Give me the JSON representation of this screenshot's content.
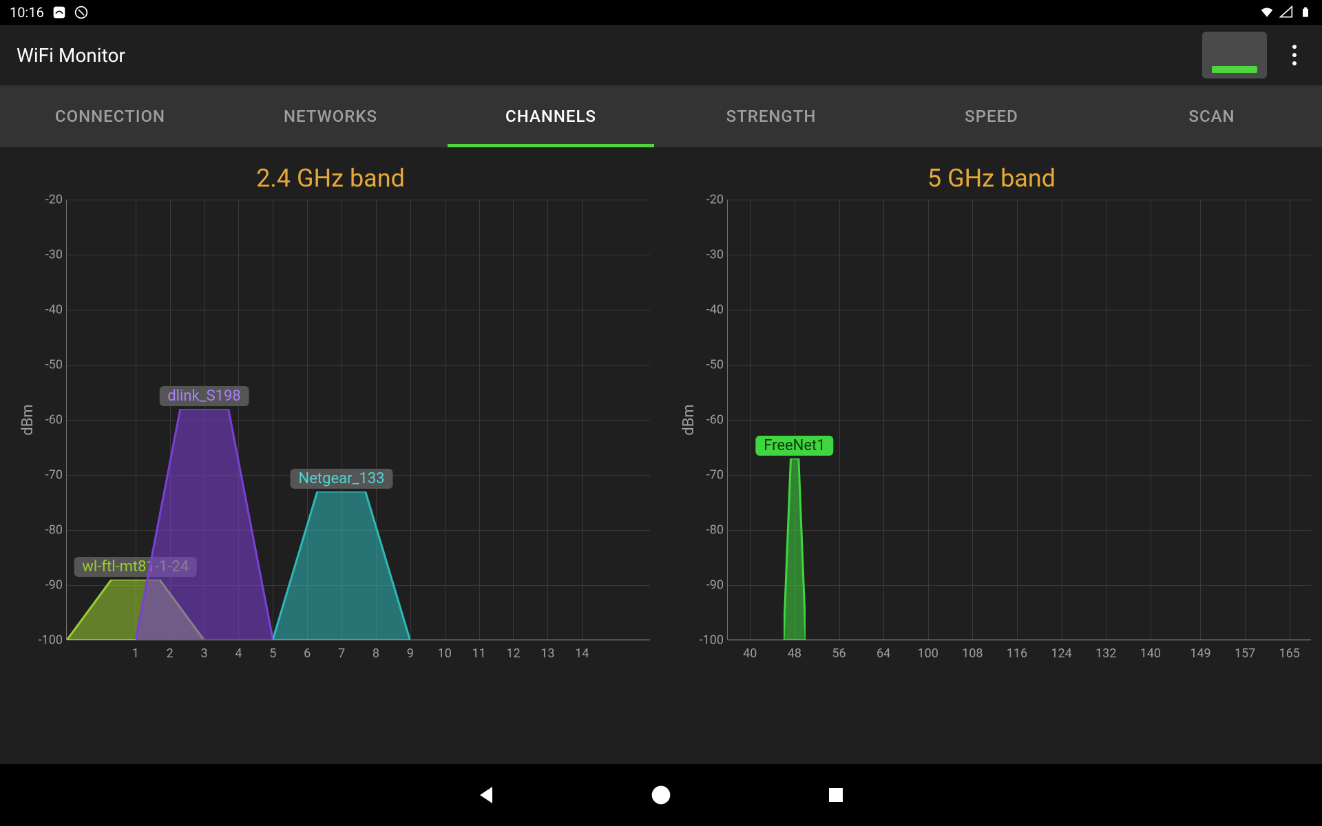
{
  "status": {
    "time": "10:16"
  },
  "app": {
    "title": "WiFi Monitor"
  },
  "tabs": [
    "CONNECTION",
    "NETWORKS",
    "CHANNELS",
    "STRENGTH",
    "SPEED",
    "SCAN"
  ],
  "active_tab": 2,
  "chart_data": [
    {
      "title": "2.4 GHz band",
      "type": "area",
      "ylabel": "dBm",
      "ylim": [
        -100,
        -20
      ],
      "yticks": [
        -20,
        -30,
        -40,
        -50,
        -60,
        -70,
        -80,
        -90,
        -100
      ],
      "xticks": [
        1,
        2,
        3,
        4,
        5,
        6,
        7,
        8,
        9,
        10,
        11,
        12,
        13,
        14
      ],
      "xrange": [
        -1,
        16
      ],
      "series": [
        {
          "name": "wl-ftl-mt81-1-24",
          "center_channel": 1,
          "width_channels": 4,
          "peak_dbm": -89,
          "color": "#9acd32",
          "label_color": "#9acd32"
        },
        {
          "name": "dlink_S198",
          "center_channel": 3,
          "width_channels": 4,
          "peak_dbm": -58,
          "color": "#7b3fd6",
          "label_color": "#a97fff"
        },
        {
          "name": "Netgear_133",
          "center_channel": 7,
          "width_channels": 4,
          "peak_dbm": -73,
          "color": "#2fb8b8",
          "label_color": "#4fd6d6"
        }
      ]
    },
    {
      "title": "5 GHz band",
      "type": "area",
      "ylabel": "dBm",
      "ylim": [
        -100,
        -20
      ],
      "yticks": [
        -20,
        -30,
        -40,
        -50,
        -60,
        -70,
        -80,
        -90,
        -100
      ],
      "xticks": [
        40,
        48,
        56,
        64,
        100,
        108,
        116,
        124,
        132,
        140,
        149,
        157,
        165
      ],
      "xrange_segments": [
        [
          36,
          68
        ],
        [
          96,
          169
        ]
      ],
      "series": [
        {
          "name": "FreeNet1",
          "center_channel": 48,
          "width_channels": 4,
          "peak_dbm": -67,
          "color": "#3fd63f",
          "label_color": "#0a4a0a"
        }
      ]
    }
  ]
}
